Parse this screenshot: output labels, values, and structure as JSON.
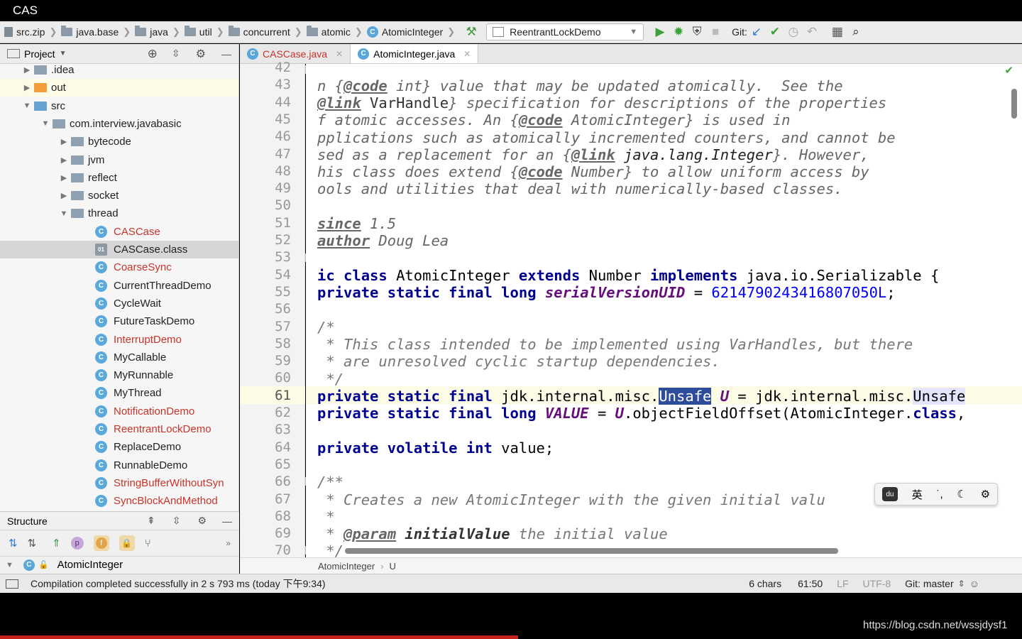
{
  "window": {
    "title": "CAS"
  },
  "navbar": {
    "crumbs": [
      "src.zip",
      "java.base",
      "java",
      "util",
      "concurrent",
      "atomic",
      "AtomicInteger"
    ],
    "run_config": "ReentrantLockDemo",
    "git_label": "Git:"
  },
  "project": {
    "header": "Project",
    "tree": [
      {
        "label": ".idea",
        "kind": "folder"
      },
      {
        "label": "out",
        "kind": "folder-orange"
      },
      {
        "label": "src",
        "kind": "folder-blue"
      },
      {
        "label": "com.interview.javabasic",
        "kind": "package"
      },
      {
        "label": "bytecode",
        "kind": "package"
      },
      {
        "label": "jvm",
        "kind": "package"
      },
      {
        "label": "reflect",
        "kind": "package"
      },
      {
        "label": "socket",
        "kind": "package"
      },
      {
        "label": "thread",
        "kind": "package"
      },
      {
        "label": "CASCase",
        "kind": "class-red"
      },
      {
        "label": "CASCase.class",
        "kind": "classfile"
      },
      {
        "label": "CoarseSync",
        "kind": "class-red"
      },
      {
        "label": "CurrentThreadDemo",
        "kind": "class"
      },
      {
        "label": "CycleWait",
        "kind": "class"
      },
      {
        "label": "FutureTaskDemo",
        "kind": "class"
      },
      {
        "label": "InterruptDemo",
        "kind": "class-red"
      },
      {
        "label": "MyCallable",
        "kind": "class"
      },
      {
        "label": "MyRunnable",
        "kind": "class"
      },
      {
        "label": "MyThread",
        "kind": "class"
      },
      {
        "label": "NotificationDemo",
        "kind": "class-red"
      },
      {
        "label": "ReentrantLockDemo",
        "kind": "class-red"
      },
      {
        "label": "ReplaceDemo",
        "kind": "class"
      },
      {
        "label": "RunnableDemo",
        "kind": "class"
      },
      {
        "label": "StringBufferWithoutSyn",
        "kind": "class-red"
      },
      {
        "label": "SyncBlockAndMethod",
        "kind": "class-red"
      }
    ]
  },
  "structure": {
    "header": "Structure",
    "root": "AtomicInteger"
  },
  "tabs": [
    {
      "label": "CASCase.java",
      "active": false
    },
    {
      "label": "AtomicInteger.java",
      "active": true
    }
  ],
  "editor": {
    "line_numbers": [
      "42",
      "43",
      "44",
      "45",
      "46",
      "47",
      "48",
      "49",
      "50",
      "51",
      "52",
      "53",
      "54",
      "55",
      "56",
      "57",
      "58",
      "59",
      "60",
      "61",
      "62",
      "63",
      "64",
      "65",
      "66",
      "67",
      "68",
      "69",
      "70"
    ],
    "breadcrumb": [
      "AtomicInteger",
      "U"
    ]
  },
  "status": {
    "message": "Compilation completed successfully in 2 s 793 ms (today 下午9:34)",
    "chars": "6 chars",
    "position": "61:50",
    "line_sep": "LF",
    "encoding": "UTF-8",
    "git_branch": "Git: master"
  },
  "ime": {
    "lang": "英"
  },
  "watermark": "https://blog.csdn.net/wssjdysf1",
  "colors": {
    "keyword": "#00008f",
    "number": "#0000ff",
    "field": "#660e7a",
    "selection": "#2d4c9c",
    "error_red": "#c9342b"
  }
}
